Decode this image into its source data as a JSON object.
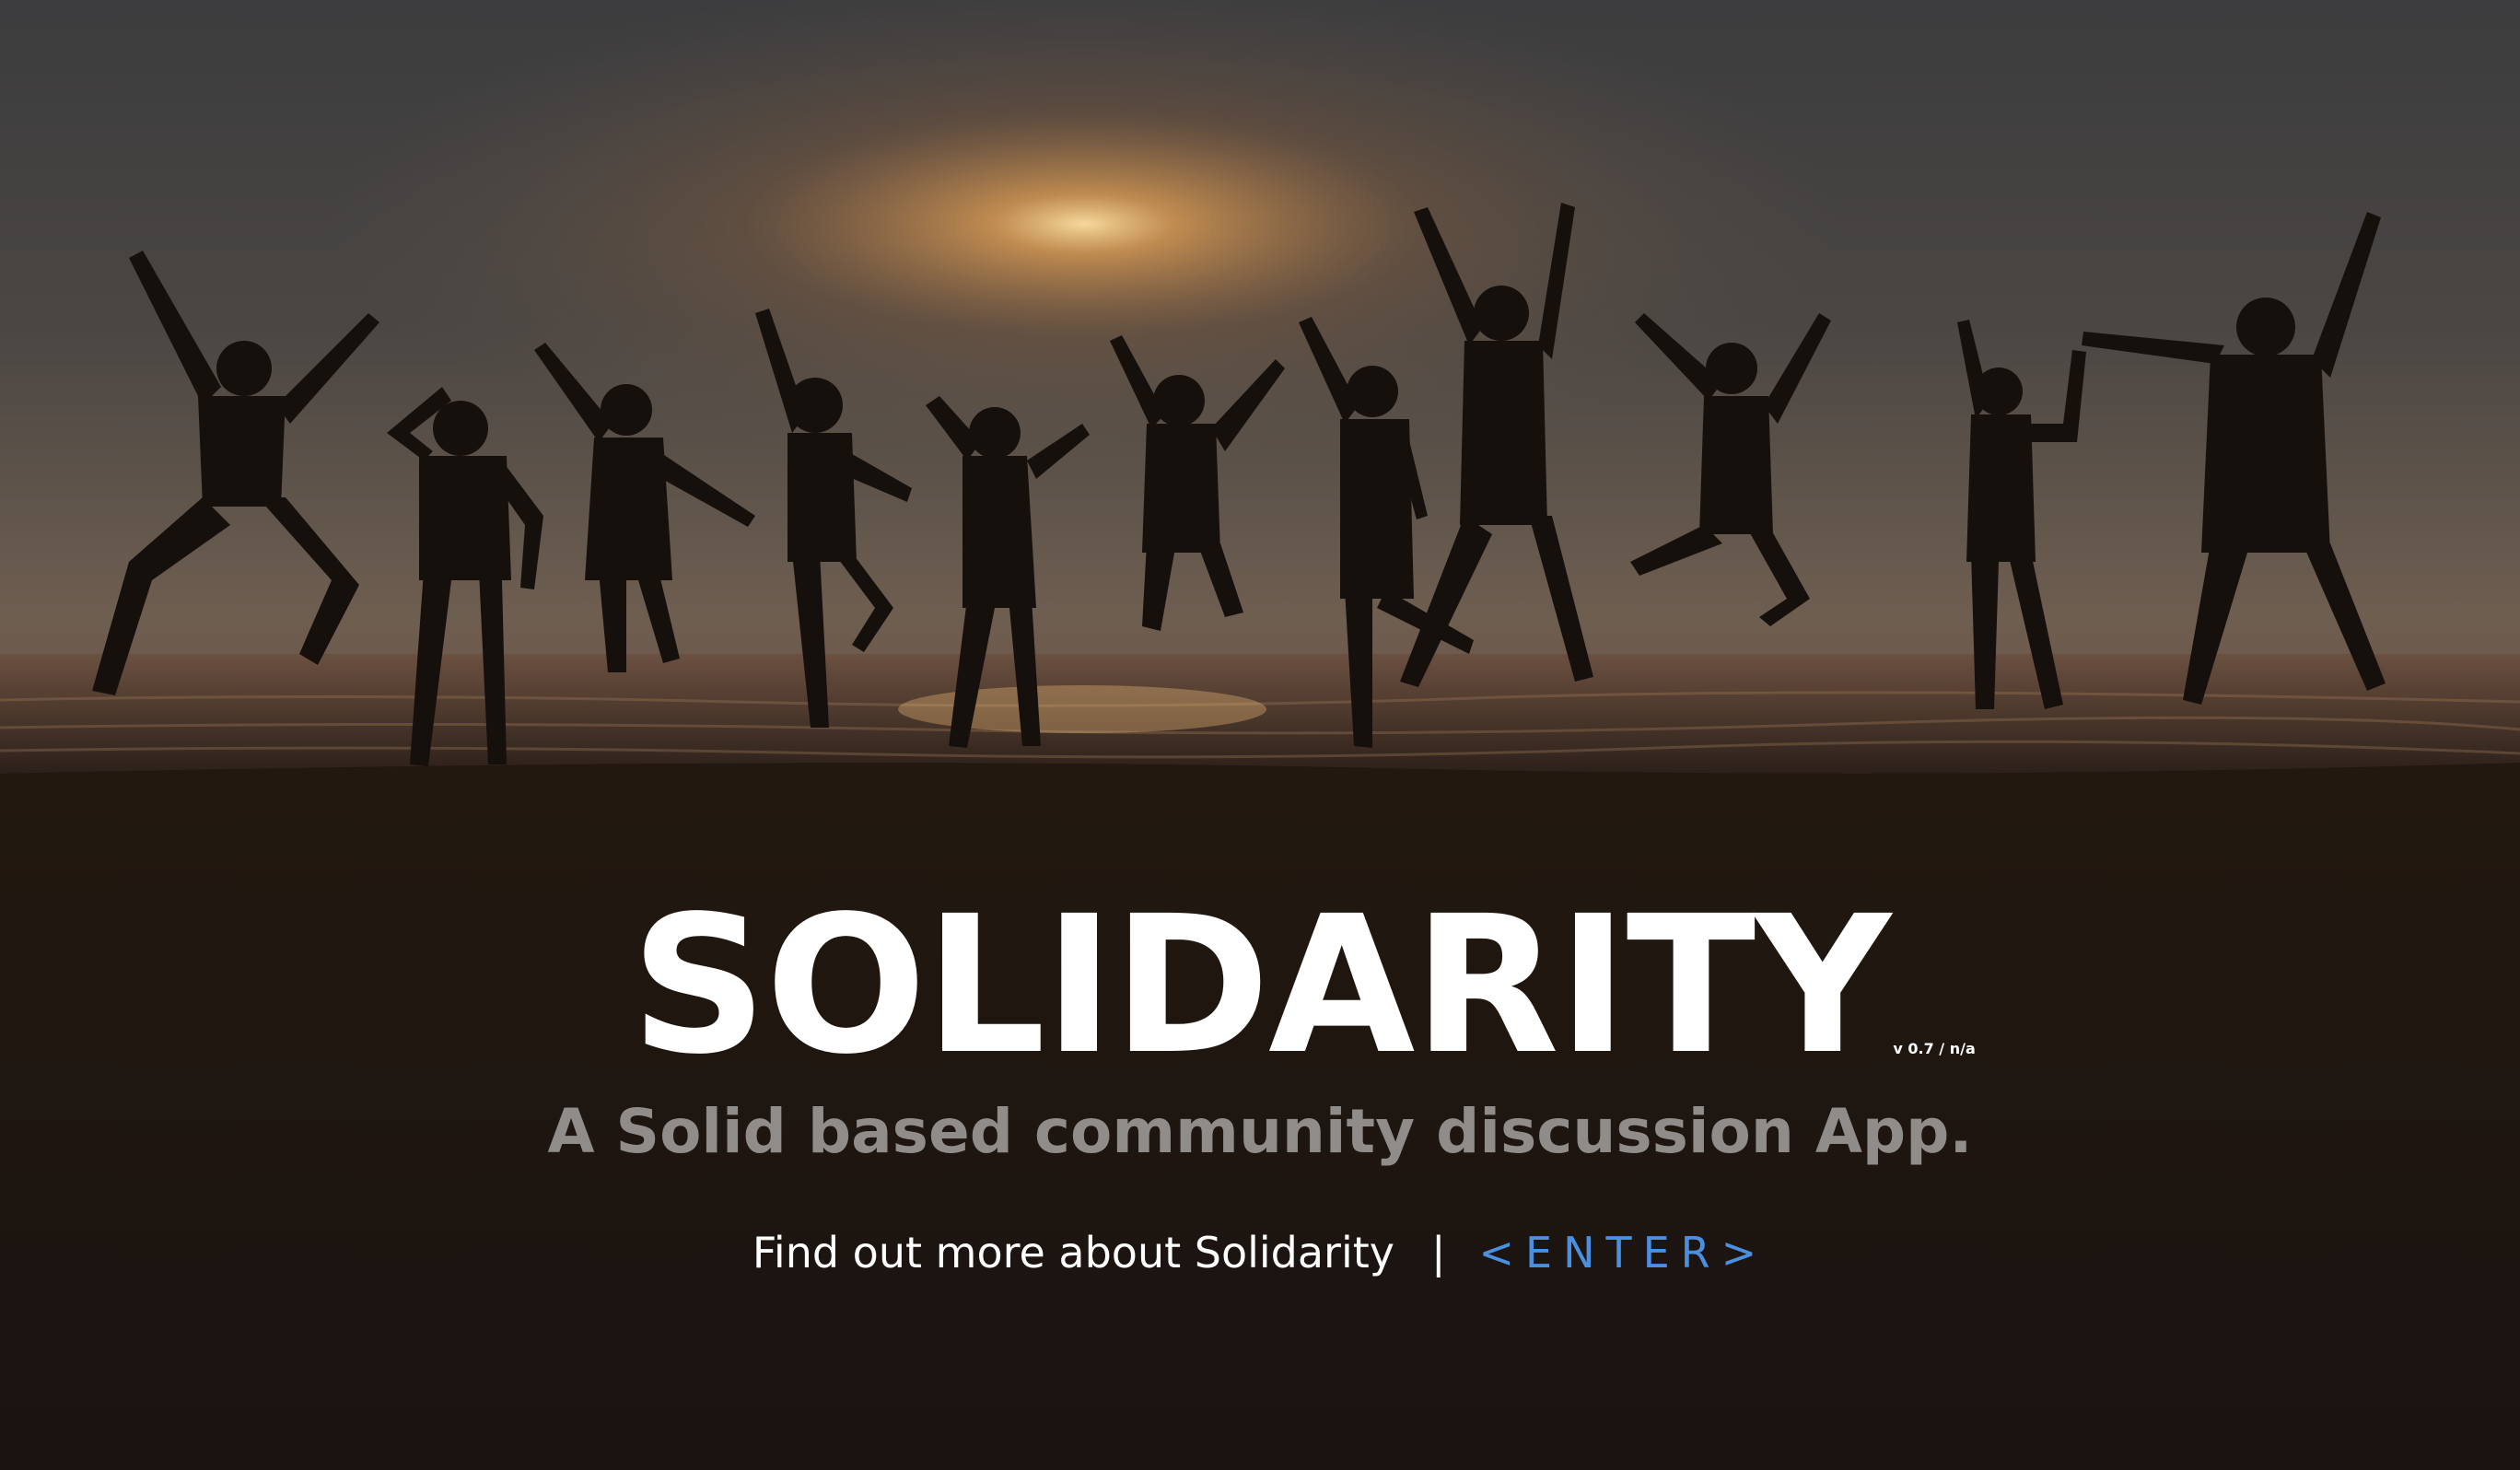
{
  "hero": {
    "image": "silhouettes of people jumping on a beach at sunset",
    "title": "SOLIDARITY",
    "version": "v 0.7 / n/a",
    "subtitle": "A Solid based community discussion App.",
    "more_link": "Find out more about Solidarity",
    "separator": "|",
    "enter_link": "<ENTER>"
  },
  "colors": {
    "title": "#ffffff",
    "subtitle": "#8f8c8a",
    "link": "#ffffff",
    "enter": "#4a8fe0",
    "sky_top": "#3c3c3e",
    "sun_glow": "#e8a355",
    "ground": "#1a1311"
  }
}
